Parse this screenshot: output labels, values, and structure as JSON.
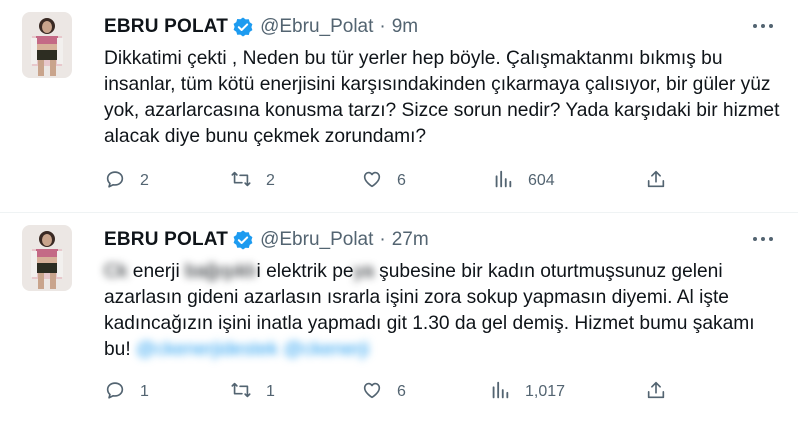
{
  "tweets": [
    {
      "author_name": "EBRU POLAT",
      "handle": "@Ebru_Polat",
      "separator": "·",
      "time": "9m",
      "text": "Dikkatimi çekti , Neden bu tür yerler hep böyle. Çalışmaktanmı bıkmış bu insanlar, tüm kötü enerjisini karşısındakinden çıkarmaya çalısıyor, bir güler yüz yok, azarlarcasına konusma tarzı? Sizce sorun nedir? Yada karşıdaki bir hizmet alacak diye bunu çekmek zorundamı?",
      "replies": "2",
      "retweets": "2",
      "likes": "6",
      "views": "604"
    },
    {
      "author_name": "EBRU POLAT",
      "handle": "@Ebru_Polat",
      "separator": "·",
      "time": "27m",
      "text_parts": {
        "p1": "Ck",
        "p2": " enerji ",
        "p3": "bağışıklı",
        "p4": "i elektrik ",
        "p5": "pe",
        "p6": "ya",
        "p7": " şubesine bir kadın oturtmuşsunuz geleni azarlasın gideni azarlasın ısrarla işini zora sokup yapmasın diyemi. Al işte kadıncağızın işini inatla yapmadı git 1.30 da gel demiş. Hizmet bumu şakamı bu! ",
        "mention1": "@ckenerjidestek",
        "mention2": "@ckenerji"
      },
      "replies": "1",
      "retweets": "1",
      "likes": "6",
      "views": "1,017"
    }
  ],
  "icons": {
    "verified": "verified-badge-icon",
    "more": "more-icon",
    "reply": "reply-icon",
    "retweet": "retweet-icon",
    "like": "like-icon",
    "views": "views-icon",
    "share": "share-icon"
  },
  "colors": {
    "text": "#0f1419",
    "muted": "#536471",
    "accent": "#1d9bf0"
  }
}
